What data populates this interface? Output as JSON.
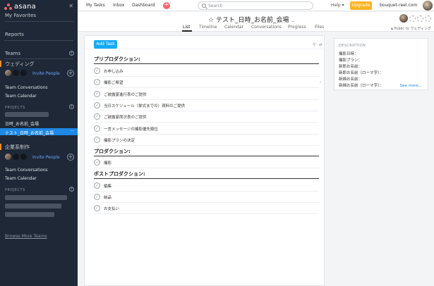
{
  "sidebar": {
    "logo": "asana",
    "favorites": "My Favorites",
    "reports": "Reports",
    "teams": "Teams",
    "team1": {
      "name": "ウェディング",
      "invite": "Invite People",
      "conversations": "Team Conversations",
      "calendar": "Team Calendar",
      "projects_label": "PROJECTS",
      "projects": [
        "日時_お名前_会場",
        "テスト_日時_お名前_会場"
      ]
    },
    "team2": {
      "name": "企業系制作",
      "invite": "Invite People",
      "conversations": "Team Conversations",
      "calendar": "Team Calendar",
      "projects_label": "PROJECTS"
    },
    "browse": "Browse More Teams",
    "colors": {
      "bg": "#1f2837",
      "active": "#1e88e5",
      "marker": "#e88e2c"
    }
  },
  "topbar": {
    "nav": [
      "My Tasks",
      "Inbox",
      "Dashboard"
    ],
    "search_placeholder": "Search",
    "help": "Help",
    "upgrade": "Upgrade",
    "domain": "bouquet-reel.com"
  },
  "project": {
    "title": "テスト_日時_お名前_会場",
    "tabs": [
      "List",
      "Timeline",
      "Calendar",
      "Conversations",
      "Progress",
      "Files"
    ],
    "active_tab": "List",
    "public_label": "Public to ウェディング"
  },
  "list": {
    "add_task": "Add Task",
    "sections": [
      {
        "name": "プリプロダクション:",
        "tasks": [
          "お申し込み",
          "撮影ご希望",
          "ご披露宴進行表のご提供",
          "当日スケジュール（挙式までの）資料のご提供",
          "ご披露宴席次表のご提供",
          "一言メッセージの撮影優先順位",
          "撮影プランの決定"
        ]
      },
      {
        "name": "プロダクション:",
        "tasks": [
          "撮影"
        ]
      },
      {
        "name": "ポストプロダクション:",
        "tasks": [
          "編集",
          "納品",
          "お支払い"
        ]
      }
    ]
  },
  "description": {
    "title": "DESCRIPTION",
    "lines": [
      "撮影日時：",
      "撮影プラン：",
      "新郎お名前：",
      "新郎お名前（ローマ字）：",
      "新婦お名前：",
      "新婦お名前（ローマ字）："
    ],
    "see_more": "See more..."
  }
}
